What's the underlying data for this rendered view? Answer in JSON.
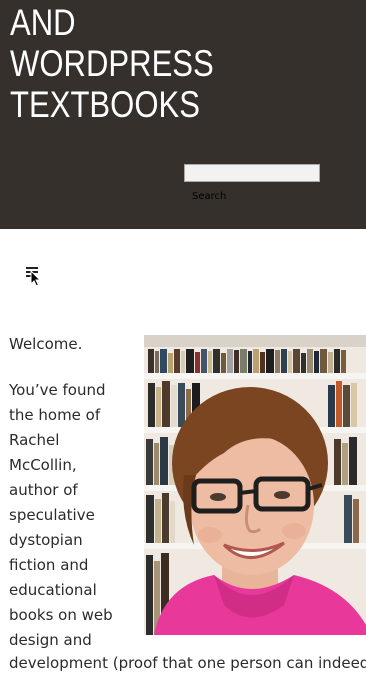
{
  "header": {
    "title_lines": [
      "AND",
      "WORDPRESS",
      "TEXTBOOKS"
    ],
    "search": {
      "value": "",
      "label": "Search"
    }
  },
  "nav": {
    "menu_icon": "hamburger-menu-icon"
  },
  "content": {
    "welcome": "Welcome.",
    "intro_lines": [
      "You’ve found",
      "the home of",
      "Rachel",
      "McCollin,",
      "author of",
      "speculative",
      "dystopian",
      "fiction and",
      "educational",
      "books on web",
      "design and"
    ],
    "intro_overflow": "development (proof that one person can indeed"
  },
  "colors": {
    "header_bg": "#35302b",
    "header_text": "#ffffff",
    "body_text": "#2b2b2b",
    "photo_top": "#f2ede6",
    "shirt": "#e8399a",
    "hair": "#7a4520"
  }
}
